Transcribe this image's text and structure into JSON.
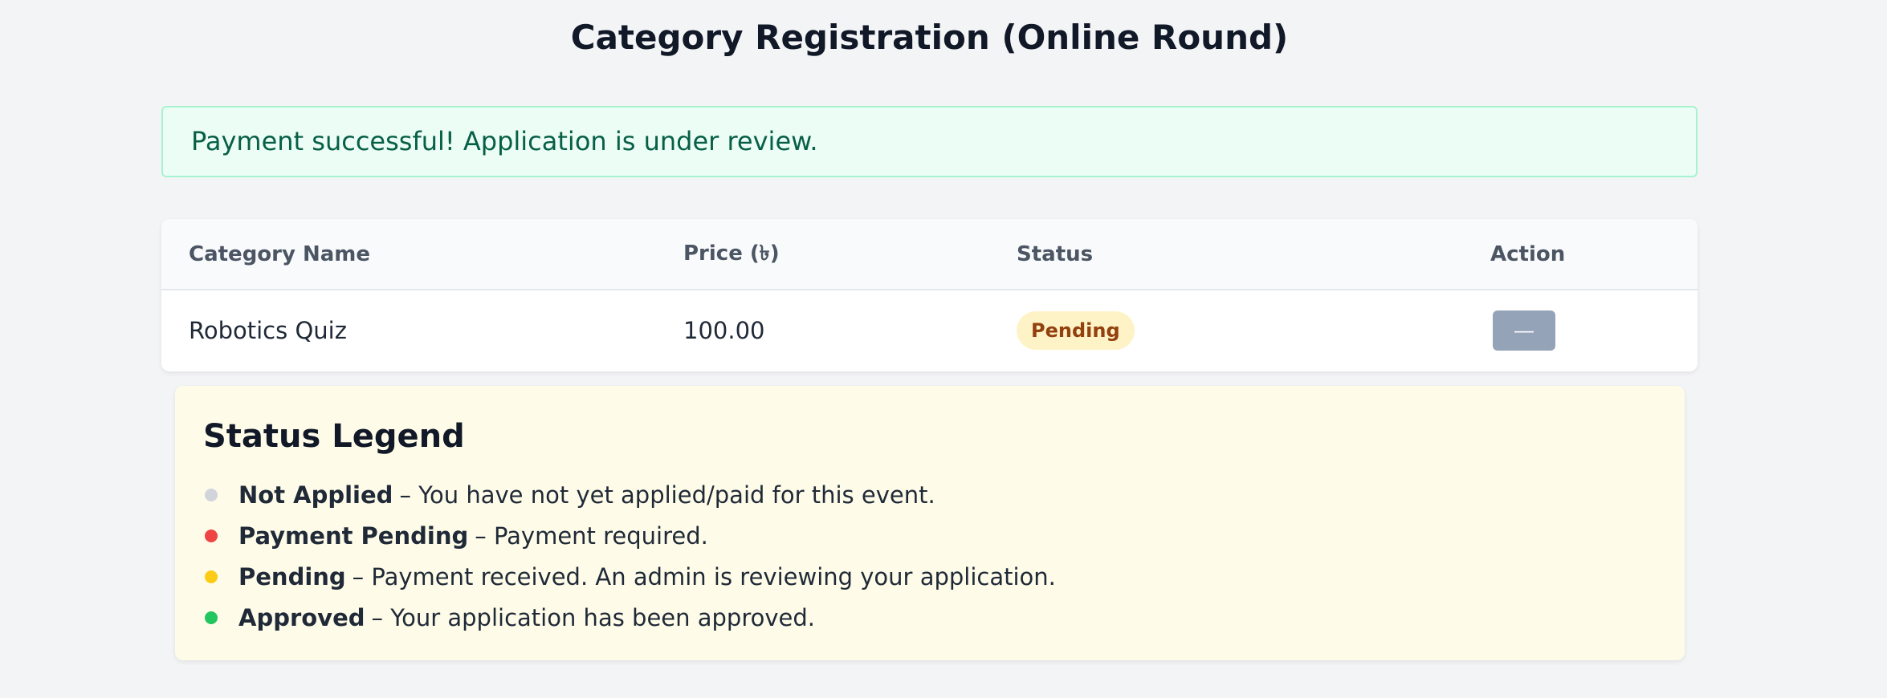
{
  "page": {
    "title": "Category Registration (Online Round)"
  },
  "alert": {
    "message": "Payment successful! Application is under review.",
    "color": "#065f46",
    "background": "#ecfdf5"
  },
  "table": {
    "headers": {
      "name": "Category Name",
      "price": "Price (৳)",
      "status": "Status",
      "action": "Action"
    },
    "rows": [
      {
        "name": "Robotics Quiz",
        "price": "100.00",
        "status": "Pending",
        "action": "—"
      }
    ]
  },
  "legend": {
    "title": "Status Legend",
    "items": [
      {
        "name": "Not Applied",
        "description": "– You have not yet applied/paid for this event.",
        "color": "#d1d5db"
      },
      {
        "name": "Payment Pending",
        "description": "– Payment required.",
        "color": "#ef4444"
      },
      {
        "name": "Pending",
        "description": "– Payment received. An admin is reviewing your application.",
        "color": "#facc15"
      },
      {
        "name": "Approved",
        "description": "– Your application has been approved.",
        "color": "#22c55e"
      }
    ]
  }
}
